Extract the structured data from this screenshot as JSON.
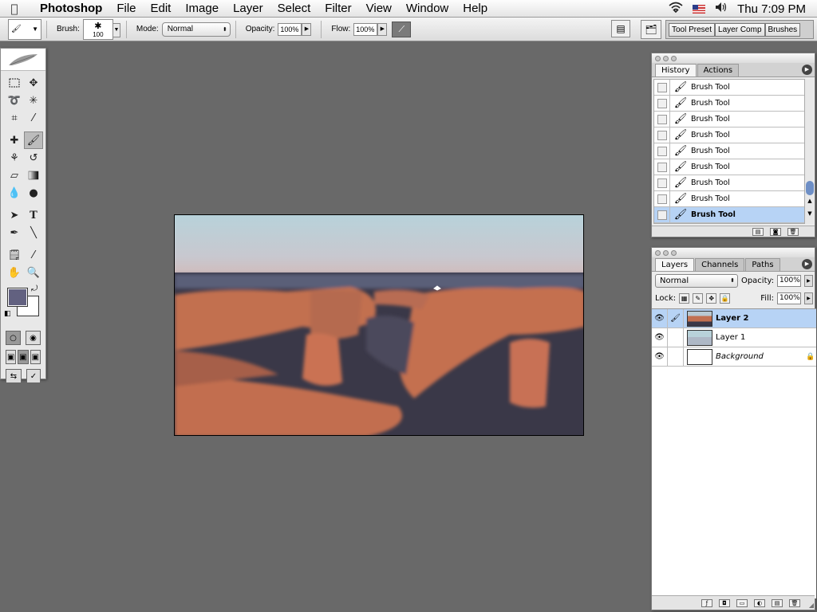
{
  "menubar": {
    "app": "Photoshop",
    "menus": [
      "File",
      "Edit",
      "Image",
      "Layer",
      "Select",
      "Filter",
      "View",
      "Window",
      "Help"
    ],
    "clock": "Thu 7:09 PM"
  },
  "options": {
    "brush_label": "Brush:",
    "brush_size": "100",
    "mode_label": "Mode:",
    "mode_value": "Normal",
    "opacity_label": "Opacity:",
    "opacity_value": "100%",
    "flow_label": "Flow:",
    "flow_value": "100%",
    "well_tabs": [
      "Tool Preset",
      "Layer Comp",
      "Brushes"
    ]
  },
  "history": {
    "tabs": [
      "History",
      "Actions"
    ],
    "items": [
      "Brush Tool",
      "Brush Tool",
      "Brush Tool",
      "Brush Tool",
      "Brush Tool",
      "Brush Tool",
      "Brush Tool",
      "Brush Tool",
      "Brush Tool"
    ],
    "selected_index": 8
  },
  "layers": {
    "tabs": [
      "Layers",
      "Channels",
      "Paths"
    ],
    "blend_mode": "Normal",
    "opacity_label": "Opacity:",
    "opacity_value": "100%",
    "lock_label": "Lock:",
    "fill_label": "Fill:",
    "fill_value": "100%",
    "items": [
      {
        "name": "Layer 2",
        "selected": true
      },
      {
        "name": "Layer 1",
        "selected": false
      },
      {
        "name": "Background",
        "selected": false,
        "locked": true
      }
    ]
  },
  "toolbox": {
    "foreground_color": "#626180",
    "background_color": "#ffffff"
  },
  "colors": {
    "workspace": "#696969",
    "selection": "#b7d3f5"
  }
}
